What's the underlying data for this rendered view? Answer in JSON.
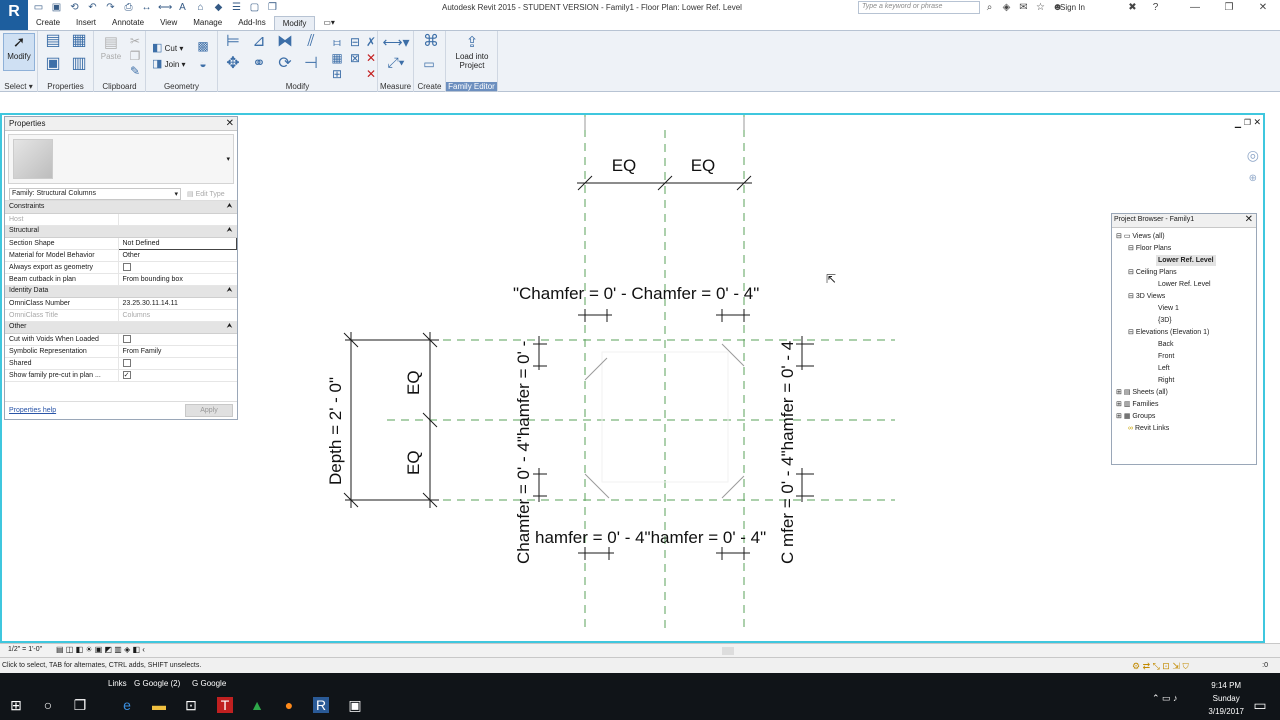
{
  "window": {
    "title": "Autodesk Revit 2015 - STUDENT VERSION -    Family1 - Floor Plan: Lower Ref. Level",
    "search_placeholder": "Type a keyword or phrase",
    "sign_in": "Sign In",
    "logo": "R"
  },
  "ribbon": {
    "tabs": [
      "Create",
      "Insert",
      "Annotate",
      "View",
      "Manage",
      "Add-Ins",
      "Modify"
    ],
    "active_tab": "Modify",
    "modify_label": "Modify",
    "select_label": "Select",
    "paste_label": "Paste",
    "cut_label": "Cut",
    "join_label": "Join",
    "load_label_1": "Load into",
    "load_label_2": "Project",
    "panels": [
      "Properties",
      "Clipboard",
      "Geometry",
      "Modify",
      "Measure",
      "Create",
      "Family Editor"
    ]
  },
  "properties": {
    "title": "Properties",
    "family": "Family: Structural Columns",
    "edit_type": "Edit Type",
    "groups": {
      "constraints": "Constraints",
      "structural": "Structural",
      "identity": "Identity Data",
      "other": "Other"
    },
    "rows": {
      "host": "Host",
      "section_shape": "Section Shape",
      "section_shape_value": "Not Defined",
      "material": "Material for Model Behavior",
      "material_value": "Other",
      "export_geom": "Always export as geometry",
      "beam_cutback": "Beam cutback in plan",
      "beam_cutback_value": "From bounding box",
      "omni_number": "OmniClass Number",
      "omni_number_value": "23.25.30.11.14.11",
      "omni_title": "OmniClass Title",
      "omni_title_value": "Columns",
      "cut_voids": "Cut with Voids When Loaded",
      "symbolic": "Symbolic Representation",
      "symbolic_value": "From Family",
      "shared": "Shared",
      "precut": "Show family pre-cut in plan ..."
    },
    "help": "Properties help",
    "apply": "Apply"
  },
  "browser": {
    "title": "Project Browser - Family1",
    "items": [
      "Views (all)",
      "Floor Plans",
      "Lower Ref. Level",
      "Ceiling Plans",
      "Lower Ref. Level",
      "3D Views",
      "View 1",
      "{3D}",
      "Elevations (Elevation 1)",
      "Back",
      "Front",
      "Left",
      "Right",
      "Sheets (all)",
      "Families",
      "Groups",
      "Revit Links"
    ]
  },
  "drawing": {
    "eq": "EQ",
    "chamfer_top_left": "\"Chamfer = 0' - Chamfer = 0' - 4\"",
    "chamfer_bottom": "hamfer = 0' - 4\"hamfer = 0' - 4\"",
    "depth": "Depth = 2' - 0\"",
    "chamfer_left_vertical": "Chamfer = 0' - 4\"hamfer = 0' - ",
    "chamfer_right_vertical": "C   mfer = 0' - 4\"hamfer = 0' - 4"
  },
  "viewbar": {
    "scale": "1/2\" = 1'-0\""
  },
  "status": {
    "text": "Click to select, TAB for alternates, CTRL adds, SHIFT unselects.",
    "filter": ":0"
  },
  "taskbar": {
    "links": "Links",
    "tab1": "Google (2)",
    "tab2": "Google",
    "time": "9:14 PM",
    "day": "Sunday",
    "date": "3/19/2017"
  },
  "colors": {
    "accent_border": "#3fc7de",
    "ref_plane": "#5aa05a",
    "ribbon_bg": "#eef2f7"
  }
}
